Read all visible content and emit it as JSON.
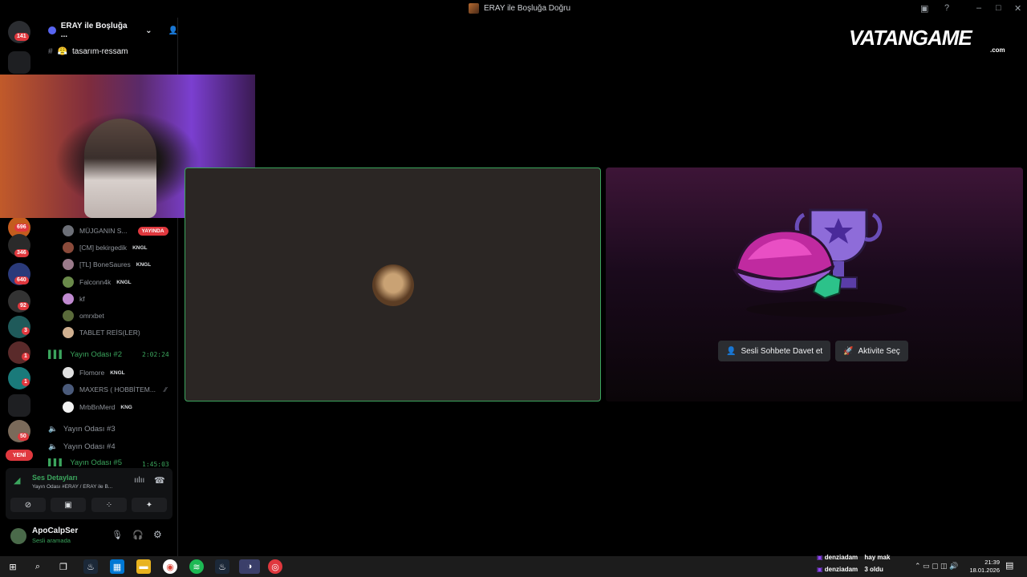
{
  "window": {
    "title": "ERAY ile Boşluğa Doğru"
  },
  "rail": {
    "badges": [
      "141",
      "696",
      "346",
      "640",
      "92",
      "3",
      "1",
      "1",
      "50"
    ],
    "new_label": "YENİ"
  },
  "sidebar": {
    "server_name": "ERAY ile Boşluğa ...",
    "current_channel": "tasarım-ressam",
    "members_room1": [
      {
        "name": "MÜJGANIN S...",
        "live": "YAYINDA"
      },
      {
        "name": "[CM] bekirgedik",
        "tag": "KNGL"
      },
      {
        "name": "[TL] BoneSaures",
        "tag": "KNGL"
      },
      {
        "name": "Falconn4k",
        "tag": "KNGL"
      },
      {
        "name": "kf"
      },
      {
        "name": "omrxbet"
      },
      {
        "name": "TABLET REİS(LER)"
      }
    ],
    "room2": {
      "name": "Yayın Odası #2",
      "time": "2:02:24"
    },
    "members_room2": [
      {
        "name": "Flomore",
        "tag": "KNGL"
      },
      {
        "name": "MAXERS ( HOBBİTEM..."
      },
      {
        "name": "MrbBnMerd",
        "tag": "KNG"
      }
    ],
    "room3": "Yayın Odası #3",
    "room4": "Yayın Odası #4",
    "room5": {
      "name": "Yayın Odası #5",
      "time": "1:45:03"
    }
  },
  "voice": {
    "title": "Ses Detayları",
    "subtitle": "Yayın Odası #ERAY / ERAY ile B..."
  },
  "user": {
    "name": "ApoCalpSer",
    "status": "Sesli aramada"
  },
  "activity": {
    "invite_label": "Sesli Sohbete Davet et",
    "choose_label": "Aktivite Seç"
  },
  "logo": {
    "main": "VATANGAME",
    "sub": ".com"
  },
  "taskbar": {
    "notifications": [
      {
        "user": "denziadam",
        "text": "hay mak"
      },
      {
        "user": "denziadam",
        "text": "3 oldu"
      }
    ],
    "time": "21:39",
    "date": "18.01.2026"
  },
  "colors": {
    "accent_green": "#3ba55d",
    "live_red": "#e0383e",
    "blurple": "#5865f2"
  }
}
